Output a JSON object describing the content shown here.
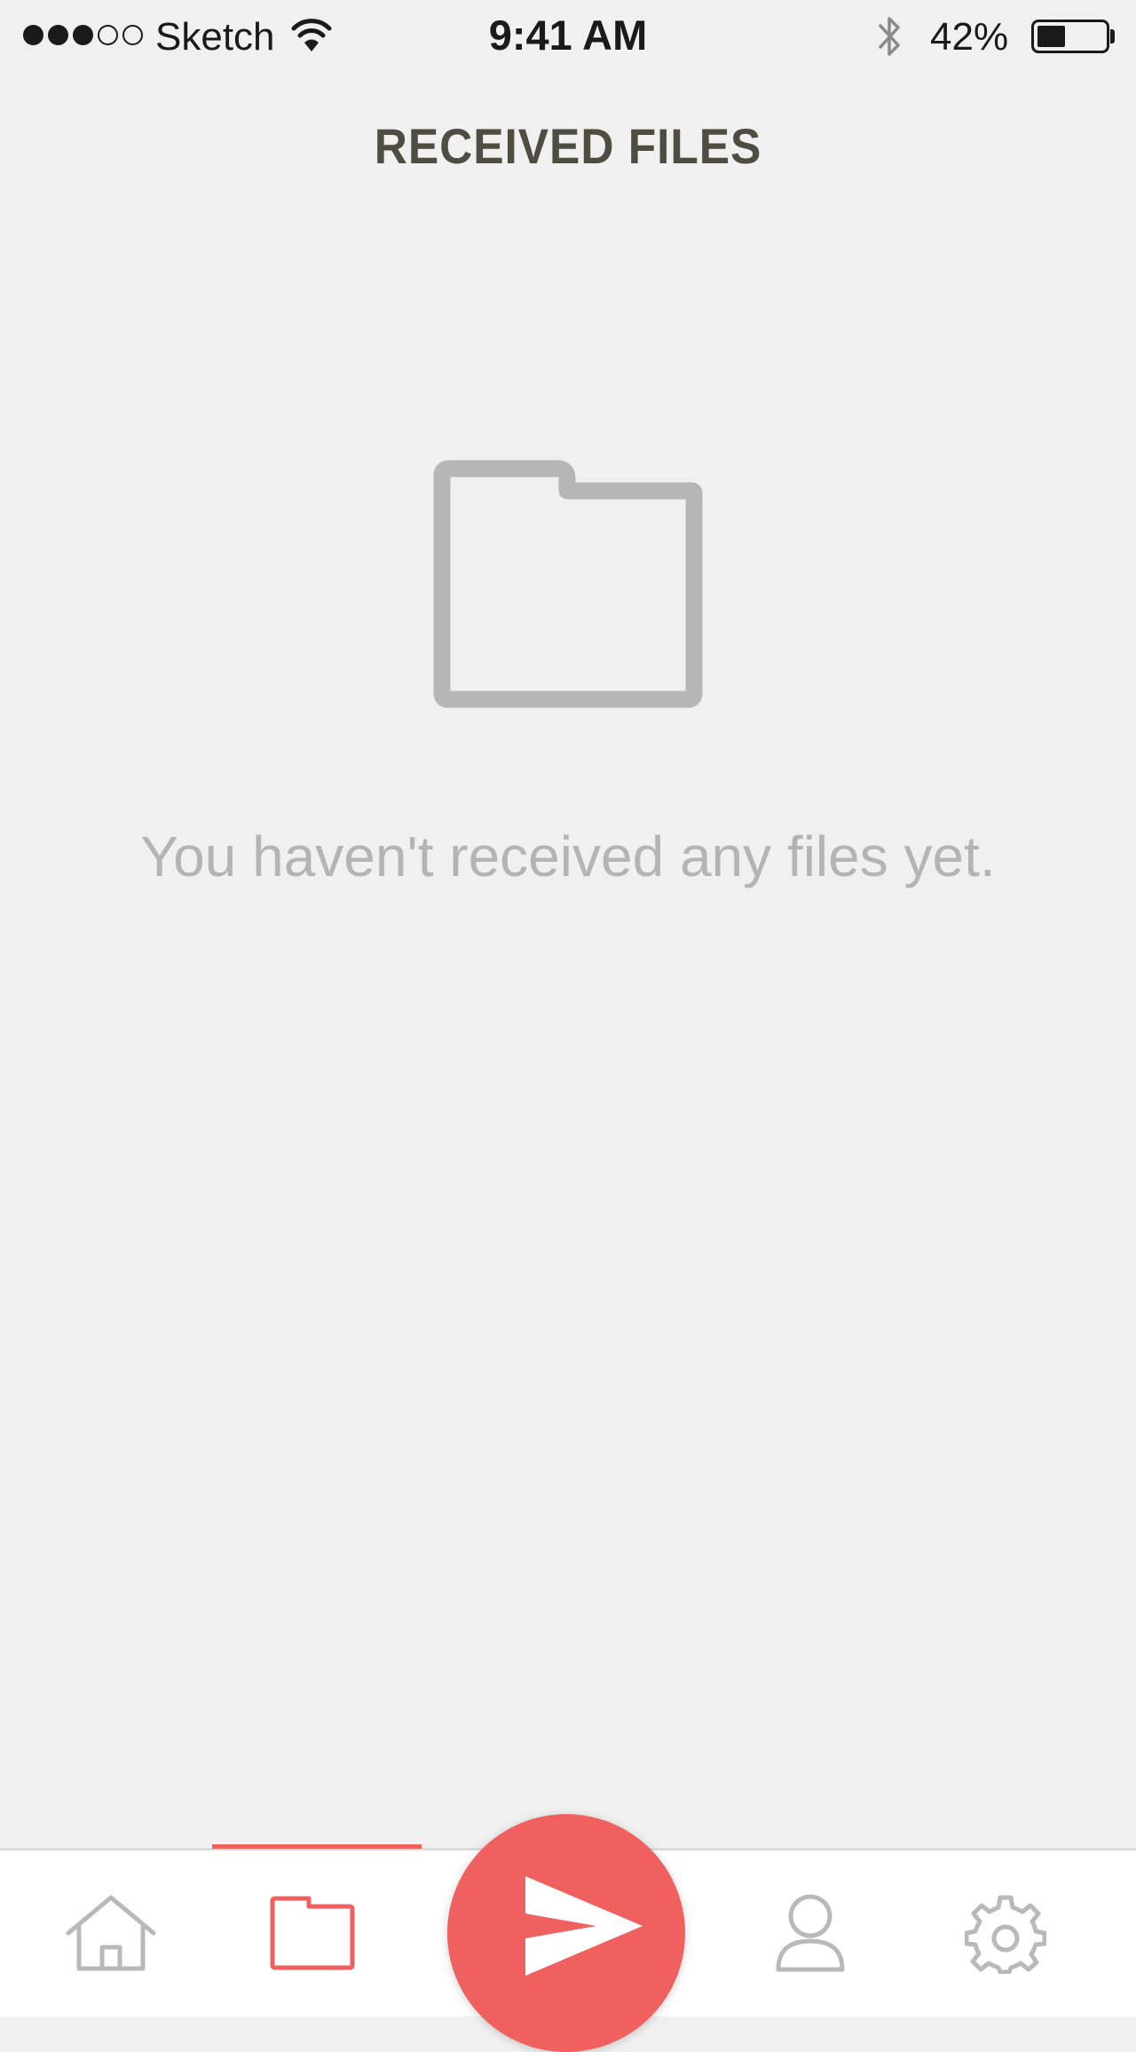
{
  "status_bar": {
    "carrier": "Sketch",
    "time": "9:41 AM",
    "battery_percent": "42%",
    "battery_level": 0.42,
    "signal_bars_filled": 3,
    "signal_bars_total": 5,
    "icons": [
      "wifi-icon",
      "bluetooth-icon",
      "battery-icon"
    ]
  },
  "header": {
    "title": "RECEIVED FILES"
  },
  "empty_state": {
    "icon": "folder-icon",
    "message": "You haven't received any files yet."
  },
  "tab_bar": {
    "items": [
      {
        "icon": "home-icon",
        "active": false
      },
      {
        "icon": "folder-icon",
        "active": true
      },
      {
        "icon": "send-icon",
        "primary": true
      },
      {
        "icon": "profile-icon",
        "active": false
      },
      {
        "icon": "gear-icon",
        "active": false
      }
    ]
  },
  "colors": {
    "accent": "#f0605f",
    "background": "#f0f0f0",
    "title": "#4d4d42",
    "muted": "#b4b4b4",
    "inactive_icon": "#b9b9b9"
  }
}
